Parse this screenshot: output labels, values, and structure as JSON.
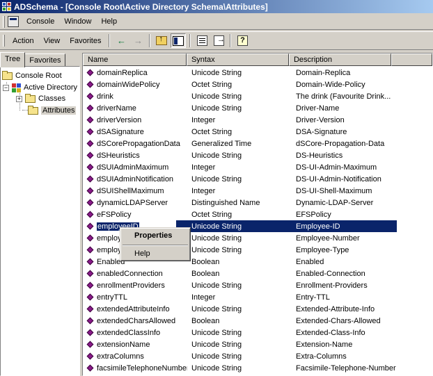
{
  "window": {
    "title": "ADSchema - [Console Root\\Active Directory Schema\\Attributes]"
  },
  "menubar": {
    "console": "Console",
    "window": "Window",
    "help": "Help"
  },
  "actionbar": {
    "action": "Action",
    "view": "View",
    "favorites": "Favorites"
  },
  "toolbar": {
    "icons": [
      "back-arrow-icon",
      "forward-arrow-icon",
      "up-one-level-icon",
      "show-hide-console-tree-icon",
      "properties-icon",
      "export-list-icon",
      "help-icon"
    ]
  },
  "left_tabs": {
    "tree": "Tree",
    "favorites": "Favorites"
  },
  "tree": {
    "root": "Console Root",
    "ad_schema": "Active Directory",
    "classes": "Classes",
    "attributes": "Attributes"
  },
  "list": {
    "columns": [
      "Name",
      "Syntax",
      "Description"
    ],
    "rows": [
      {
        "name": "domainReplica",
        "syntax": "Unicode String",
        "desc": "Domain-Replica"
      },
      {
        "name": "domainWidePolicy",
        "syntax": "Octet String",
        "desc": "Domain-Wide-Policy"
      },
      {
        "name": "drink",
        "syntax": "Unicode String",
        "desc": "The drink (Favourite Drink..."
      },
      {
        "name": "driverName",
        "syntax": "Unicode String",
        "desc": "Driver-Name"
      },
      {
        "name": "driverVersion",
        "syntax": "Integer",
        "desc": "Driver-Version"
      },
      {
        "name": "dSASignature",
        "syntax": "Octet String",
        "desc": "DSA-Signature"
      },
      {
        "name": "dSCorePropagationData",
        "syntax": "Generalized Time",
        "desc": "dSCore-Propagation-Data"
      },
      {
        "name": "dSHeuristics",
        "syntax": "Unicode String",
        "desc": "DS-Heuristics"
      },
      {
        "name": "dSUIAdminMaximum",
        "syntax": "Integer",
        "desc": "DS-UI-Admin-Maximum"
      },
      {
        "name": "dSUIAdminNotification",
        "syntax": "Unicode String",
        "desc": "DS-UI-Admin-Notification"
      },
      {
        "name": "dSUIShellMaximum",
        "syntax": "Integer",
        "desc": "DS-UI-Shell-Maximum"
      },
      {
        "name": "dynamicLDAPServer",
        "syntax": "Distinguished Name",
        "desc": "Dynamic-LDAP-Server"
      },
      {
        "name": "eFSPolicy",
        "syntax": "Octet String",
        "desc": "EFSPolicy"
      },
      {
        "name": "employeeID",
        "syntax": "Unicode String",
        "desc": "Employee-ID",
        "selected": true
      },
      {
        "name": "employ",
        "syntax": "Unicode String",
        "desc": "Employee-Number"
      },
      {
        "name": "employ",
        "syntax": "Unicode String",
        "desc": "Employee-Type"
      },
      {
        "name": "Enabled",
        "syntax": "Boolean",
        "desc": "Enabled"
      },
      {
        "name": "enabledConnection",
        "syntax": "Boolean",
        "desc": "Enabled-Connection"
      },
      {
        "name": "enrollmentProviders",
        "syntax": "Unicode String",
        "desc": "Enrollment-Providers"
      },
      {
        "name": "entryTTL",
        "syntax": "Integer",
        "desc": "Entry-TTL"
      },
      {
        "name": "extendedAttributeInfo",
        "syntax": "Unicode String",
        "desc": "Extended-Attribute-Info"
      },
      {
        "name": "extendedCharsAllowed",
        "syntax": "Boolean",
        "desc": "Extended-Chars-Allowed"
      },
      {
        "name": "extendedClassInfo",
        "syntax": "Unicode String",
        "desc": "Extended-Class-Info"
      },
      {
        "name": "extensionName",
        "syntax": "Unicode String",
        "desc": "Extension-Name"
      },
      {
        "name": "extraColumns",
        "syntax": "Unicode String",
        "desc": "Extra-Columns"
      },
      {
        "name": "facsimileTelephoneNumber",
        "syntax": "Unicode String",
        "desc": "Facsimile-Telephone-Number"
      }
    ]
  },
  "context_menu": {
    "properties": "Properties",
    "help": "Help"
  },
  "colors": {
    "title_start": "#0a246a",
    "title_end": "#a6caf0",
    "selection": "#0a246a",
    "face": "#d4d0c8"
  }
}
